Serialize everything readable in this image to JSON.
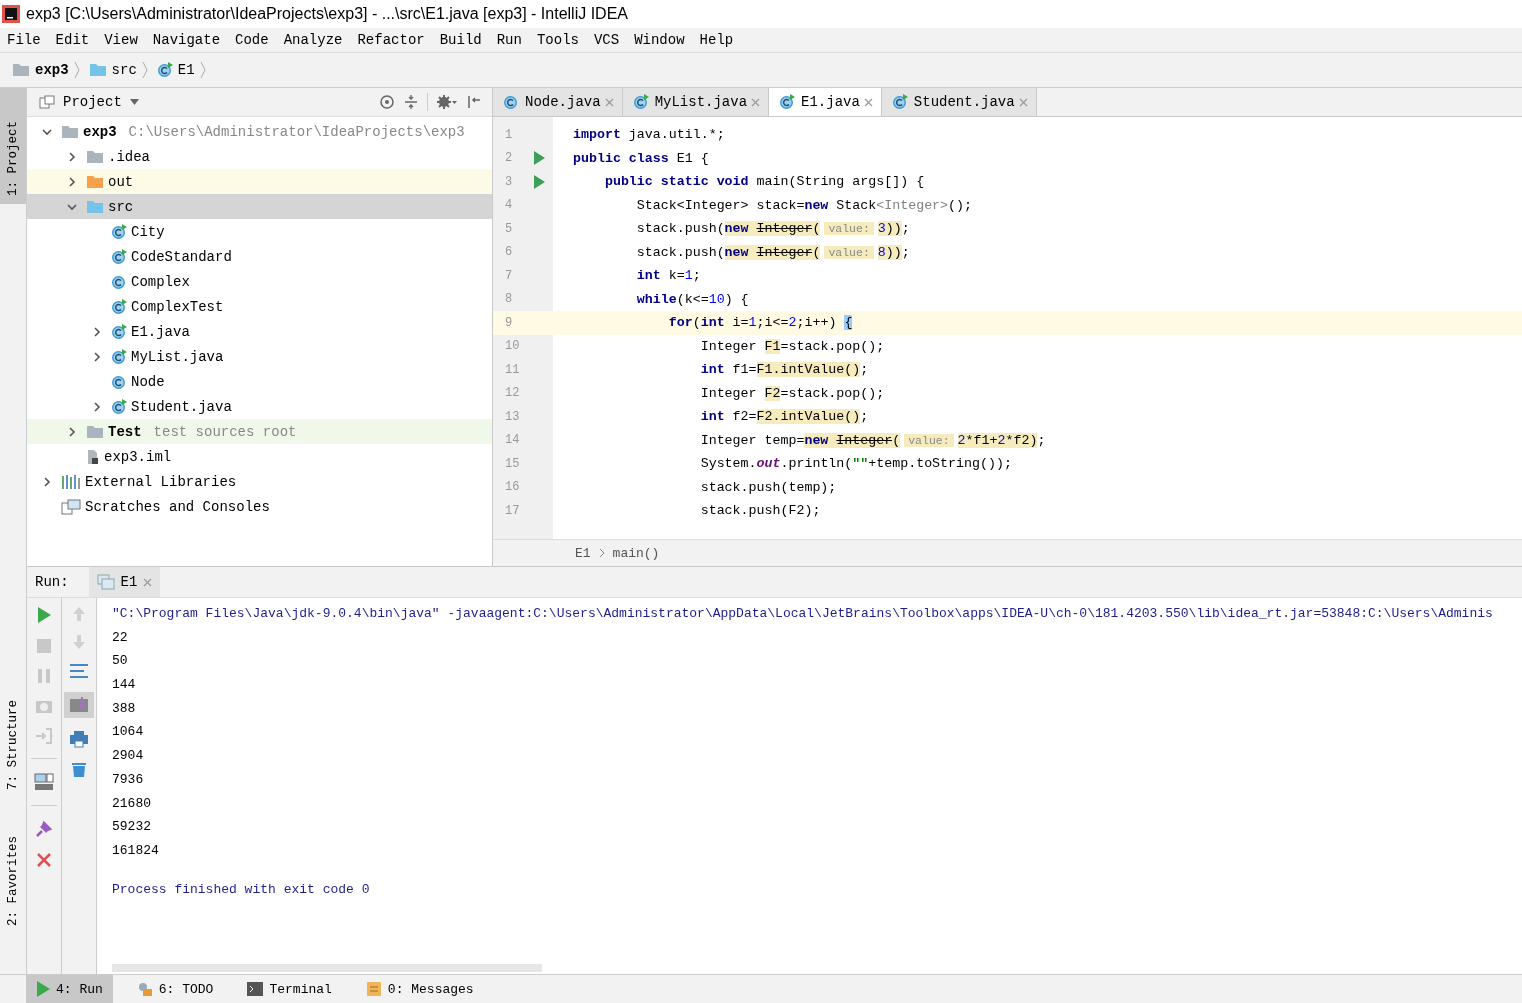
{
  "window": {
    "title": "exp3 [C:\\Users\\Administrator\\IdeaProjects\\exp3] - ...\\src\\E1.java [exp3] - IntelliJ IDEA"
  },
  "menu": [
    "File",
    "Edit",
    "View",
    "Navigate",
    "Code",
    "Analyze",
    "Refactor",
    "Build",
    "Run",
    "Tools",
    "VCS",
    "Window",
    "Help"
  ],
  "breadcrumbs": [
    {
      "label": "exp3",
      "kind": "module"
    },
    {
      "label": "src",
      "kind": "folder"
    },
    {
      "label": "E1",
      "kind": "class"
    }
  ],
  "left_stripe": [
    {
      "label": "1: Project",
      "selected": true
    },
    {
      "label": "7: Structure",
      "selected": false
    },
    {
      "label": "2: Favorites",
      "selected": false
    }
  ],
  "project": {
    "title": "Project",
    "tree": [
      {
        "label": "exp3",
        "kind": "module",
        "hint": "C:\\Users\\Administrator\\IdeaProjects\\exp3",
        "expanded": true,
        "selected": false,
        "children": [
          {
            "label": ".idea",
            "kind": "folder",
            "expanded": false,
            "selected": false
          },
          {
            "label": "out",
            "kind": "excluded",
            "expanded": false,
            "selected": false
          },
          {
            "label": "src",
            "kind": "source",
            "expanded": true,
            "selected": true,
            "children": [
              {
                "label": "City",
                "kind": "class",
                "runnable": true,
                "selected": false
              },
              {
                "label": "CodeStandard",
                "kind": "class",
                "runnable": true,
                "selected": false
              },
              {
                "label": "Complex",
                "kind": "class",
                "runnable": false,
                "selected": false
              },
              {
                "label": "ComplexTest",
                "kind": "class",
                "runnable": true,
                "selected": false
              },
              {
                "label": "E1.java",
                "kind": "class",
                "runnable": true,
                "expanded": false,
                "selected": false
              },
              {
                "label": "MyList.java",
                "kind": "class",
                "runnable": true,
                "expanded": false,
                "selected": false
              },
              {
                "label": "Node",
                "kind": "class",
                "runnable": false,
                "selected": false
              },
              {
                "label": "Student.java",
                "kind": "class",
                "runnable": true,
                "expanded": false,
                "selected": false
              }
            ]
          },
          {
            "label": "Test",
            "kind": "test",
            "hint": "test sources root",
            "expanded": false,
            "selected": false
          },
          {
            "label": "exp3.iml",
            "kind": "file",
            "selected": false
          }
        ]
      },
      {
        "label": "External Libraries",
        "kind": "libraries",
        "expanded": false,
        "selected": false
      },
      {
        "label": "Scratches and Consoles",
        "kind": "scratches",
        "selected": false
      }
    ]
  },
  "editor": {
    "tabs": [
      {
        "label": "Node.java",
        "runnable": false,
        "selected": false
      },
      {
        "label": "MyList.java",
        "runnable": true,
        "selected": false
      },
      {
        "label": "E1.java",
        "runnable": true,
        "selected": true
      },
      {
        "label": "Student.java",
        "runnable": true,
        "selected": false
      }
    ],
    "lines": [
      {
        "number": "1",
        "run_marker": false,
        "current": false,
        "tokens": [
          {
            "text": "import",
            "kind": "keyword"
          },
          {
            "text": " java.util.*;",
            "kind": "plain"
          }
        ]
      },
      {
        "number": "2",
        "run_marker": true,
        "current": false,
        "tokens": [
          {
            "text": "public class",
            "kind": "keyword"
          },
          {
            "text": " E1 {",
            "kind": "plain"
          }
        ]
      },
      {
        "number": "3",
        "run_marker": true,
        "current": false,
        "tokens": [
          {
            "text": "    public static void",
            "kind": "keyword"
          },
          {
            "text": " main(String args[]) {",
            "kind": "plain"
          }
        ]
      },
      {
        "number": "4",
        "run_marker": false,
        "current": false,
        "tokens": [
          {
            "text": "        Stack<Integer> stack=",
            "kind": "plain"
          },
          {
            "text": "new",
            "kind": "keyword"
          },
          {
            "text": " Stack",
            "kind": "plain"
          },
          {
            "text": "<Integer>",
            "kind": "generic"
          },
          {
            "text": "();",
            "kind": "plain"
          }
        ]
      },
      {
        "number": "5",
        "run_marker": false,
        "current": false,
        "tokens": [
          {
            "text": "        stack.push(",
            "kind": "plain"
          },
          {
            "text": "new ",
            "kind": "keyword",
            "warn": true
          },
          {
            "text": "Integer",
            "kind": "deprecated",
            "warn": true
          },
          {
            "text": "(",
            "kind": "plain",
            "warn": true
          },
          {
            "text": "value:",
            "kind": "hint",
            "warn": true
          },
          {
            "text": "3",
            "kind": "number",
            "warn": true
          },
          {
            "text": "))",
            "kind": "plain",
            "warn": true
          },
          {
            "text": ";",
            "kind": "plain"
          }
        ]
      },
      {
        "number": "6",
        "run_marker": false,
        "current": false,
        "tokens": [
          {
            "text": "        stack.push(",
            "kind": "plain"
          },
          {
            "text": "new ",
            "kind": "keyword",
            "warn": true
          },
          {
            "text": "Integer",
            "kind": "deprecated",
            "warn": true
          },
          {
            "text": "(",
            "kind": "plain",
            "warn": true
          },
          {
            "text": "value:",
            "kind": "hint",
            "warn": true
          },
          {
            "text": "8",
            "kind": "number",
            "warn": true
          },
          {
            "text": "))",
            "kind": "plain",
            "warn": true
          },
          {
            "text": ";",
            "kind": "plain"
          }
        ]
      },
      {
        "number": "7",
        "run_marker": false,
        "current": false,
        "tokens": [
          {
            "text": "        int",
            "kind": "keyword"
          },
          {
            "text": " k=",
            "kind": "plain"
          },
          {
            "text": "1",
            "kind": "number"
          },
          {
            "text": ";",
            "kind": "plain"
          }
        ]
      },
      {
        "number": "8",
        "run_marker": false,
        "current": false,
        "tokens": [
          {
            "text": "        while",
            "kind": "keyword"
          },
          {
            "text": "(k<=",
            "kind": "plain"
          },
          {
            "text": "10",
            "kind": "number"
          },
          {
            "text": ") {",
            "kind": "plain"
          }
        ]
      },
      {
        "number": "9",
        "run_marker": false,
        "current": true,
        "tokens": [
          {
            "text": "            for",
            "kind": "keyword"
          },
          {
            "text": "(",
            "kind": "plain"
          },
          {
            "text": "int",
            "kind": "keyword"
          },
          {
            "text": " i=",
            "kind": "plain"
          },
          {
            "text": "1",
            "kind": "number"
          },
          {
            "text": ";i<=",
            "kind": "plain"
          },
          {
            "text": "2",
            "kind": "number"
          },
          {
            "text": ";i++) ",
            "kind": "plain"
          },
          {
            "text": "{",
            "kind": "brace_match"
          }
        ]
      },
      {
        "number": "10",
        "run_marker": false,
        "current": false,
        "tokens": [
          {
            "text": "                Integer ",
            "kind": "plain"
          },
          {
            "text": "F1",
            "kind": "plain",
            "warn": true
          },
          {
            "text": "=stack.pop();",
            "kind": "plain"
          }
        ]
      },
      {
        "number": "11",
        "run_marker": false,
        "current": false,
        "tokens": [
          {
            "text": "                int",
            "kind": "keyword"
          },
          {
            "text": " f1=",
            "kind": "plain"
          },
          {
            "text": "F1.intValue()",
            "kind": "plain",
            "warn": true
          },
          {
            "text": ";",
            "kind": "plain"
          }
        ]
      },
      {
        "number": "12",
        "run_marker": false,
        "current": false,
        "tokens": [
          {
            "text": "                Integer ",
            "kind": "plain"
          },
          {
            "text": "F2",
            "kind": "plain",
            "warn": true
          },
          {
            "text": "=stack.pop();",
            "kind": "plain"
          }
        ]
      },
      {
        "number": "13",
        "run_marker": false,
        "current": false,
        "tokens": [
          {
            "text": "                int",
            "kind": "keyword"
          },
          {
            "text": " f2=",
            "kind": "plain"
          },
          {
            "text": "F2.intValue()",
            "kind": "plain",
            "warn": true
          },
          {
            "text": ";",
            "kind": "plain"
          }
        ]
      },
      {
        "number": "14",
        "run_marker": false,
        "current": false,
        "tokens": [
          {
            "text": "                Integer temp=",
            "kind": "plain"
          },
          {
            "text": "new ",
            "kind": "keyword",
            "warn": true
          },
          {
            "text": "Integer",
            "kind": "deprecated",
            "warn": true
          },
          {
            "text": "(",
            "kind": "plain",
            "warn": true
          },
          {
            "text": "value:",
            "kind": "hint",
            "warn": true
          },
          {
            "text": "2",
            "kind": "number",
            "warn": true
          },
          {
            "text": "*f1+",
            "kind": "plain",
            "warn": true
          },
          {
            "text": "2",
            "kind": "number",
            "warn": true
          },
          {
            "text": "*f2)",
            "kind": "plain",
            "warn": true
          },
          {
            "text": ";",
            "kind": "plain"
          }
        ]
      },
      {
        "number": "15",
        "run_marker": false,
        "current": false,
        "tokens": [
          {
            "text": "                System.",
            "kind": "plain"
          },
          {
            "text": "out",
            "kind": "static"
          },
          {
            "text": ".println(",
            "kind": "plain"
          },
          {
            "text": "\"\"",
            "kind": "string"
          },
          {
            "text": "+temp.toString());",
            "kind": "plain"
          }
        ]
      },
      {
        "number": "16",
        "run_marker": false,
        "current": false,
        "tokens": [
          {
            "text": "                stack.push(temp);",
            "kind": "plain"
          }
        ]
      },
      {
        "number": "17",
        "run_marker": false,
        "current": false,
        "tokens": [
          {
            "text": "                stack.push(F2);",
            "kind": "plain"
          }
        ]
      }
    ],
    "breadcrumbs": [
      "E1",
      "main()"
    ]
  },
  "run": {
    "label": "Run:",
    "tabs": [
      {
        "label": "E1",
        "selected": true
      }
    ],
    "output": [
      {
        "text": "\"C:\\Program Files\\Java\\jdk-9.0.4\\bin\\java\" -javaagent:C:\\Users\\Administrator\\AppData\\Local\\JetBrains\\Toolbox\\apps\\IDEA-U\\ch-0\\181.4203.550\\lib\\idea_rt.jar=53848:C:\\Users\\Adminis",
        "kind": "command"
      },
      {
        "text": "22",
        "kind": "stdout"
      },
      {
        "text": "50",
        "kind": "stdout"
      },
      {
        "text": "144",
        "kind": "stdout"
      },
      {
        "text": "388",
        "kind": "stdout"
      },
      {
        "text": "1064",
        "kind": "stdout"
      },
      {
        "text": "2904",
        "kind": "stdout"
      },
      {
        "text": "7936",
        "kind": "stdout"
      },
      {
        "text": "21680",
        "kind": "stdout"
      },
      {
        "text": "59232",
        "kind": "stdout"
      },
      {
        "text": "161824",
        "kind": "stdout"
      },
      {
        "text": "Process finished with exit code 0",
        "kind": "system"
      }
    ]
  },
  "tool_windows": [
    {
      "label": "4: Run",
      "kind": "run",
      "selected": true
    },
    {
      "label": "6: TODO",
      "kind": "todo",
      "selected": false
    },
    {
      "label": "Terminal",
      "kind": "terminal",
      "selected": false
    },
    {
      "label": "0: Messages",
      "kind": "messages",
      "selected": false
    }
  ]
}
